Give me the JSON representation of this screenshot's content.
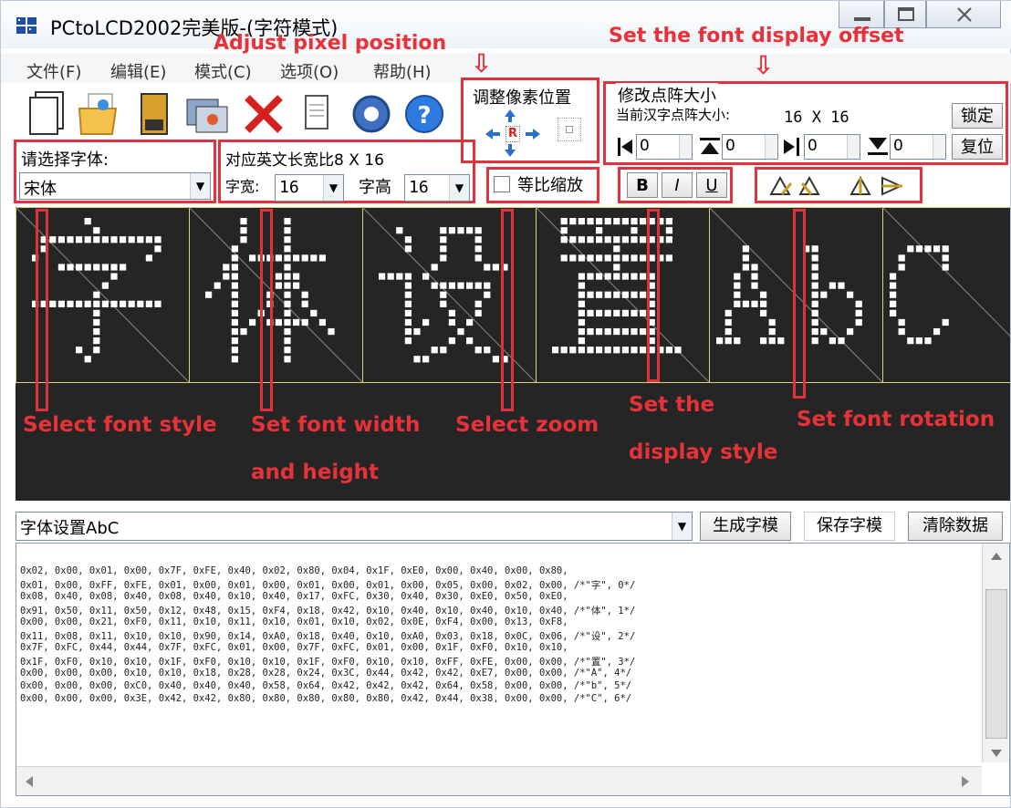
{
  "window": {
    "title": "PCtoLCD2002完美版-(字符模式)"
  },
  "menu": [
    "文件(F)",
    "编辑(E)",
    "模式(C)",
    "选项(O)",
    "帮助(H)"
  ],
  "toolbar": {
    "icons": [
      "new-file-icon",
      "open-folder-icon",
      "save-disk-icon",
      "settings-window-icon",
      "delete-x-icon",
      "notepad-icon",
      "gear-icon",
      "help-icon"
    ]
  },
  "pixel_group": {
    "label": "调整像素位置",
    "reset_label": "R"
  },
  "dot_group": {
    "label": "修改点阵大小",
    "size_label": "当前汉字点阵大小:",
    "size_value": "16 X 16",
    "lock_button": "锁定",
    "reset_button": "复位",
    "spin_values": [
      "0",
      "0",
      "0",
      "0"
    ]
  },
  "font_select": {
    "label": "请选择字体:",
    "value": "宋体"
  },
  "ratio_label": "对应英文长宽比8 X 16",
  "width_label": "字宽:",
  "width_value": "16",
  "height_label": "字高",
  "height_value": "16",
  "zoom_checkbox": "等比缩放",
  "style_buttons": [
    "B",
    "I",
    "U"
  ],
  "preview_text": "字体设置AbC",
  "annotations": {
    "adjust_pixel": "Adjust pixel position",
    "set_offset": "Set the font display offset",
    "font_style": "Select font style",
    "font_wh_1": "Set font width",
    "font_wh_2": "and height",
    "zoom": "Select zoom",
    "display_1": "Set the",
    "display_2": "display style",
    "rotation": "Set font rotation",
    "arrow_glyph": "⇩"
  },
  "bottom": {
    "input_value": "字体设置AbC",
    "generate_button": "生成字模",
    "save_button": "保存字模",
    "clear_button": "清除数据"
  },
  "output_lines": [
    "0x02, 0x00, 0x01, 0x00, 0x7F, 0xFE, 0x40, 0x02, 0x80, 0x04, 0x1F, 0xE0, 0x00, 0x40, 0x00, 0x80,",
    "0x01, 0x00, 0xFF, 0xFE, 0x01, 0x00, 0x01, 0x00, 0x01, 0x00, 0x01, 0x00, 0x05, 0x00, 0x02, 0x00, /*\"字\", 0*/",
    "0x08, 0x40, 0x08, 0x40, 0x08, 0x40, 0x10, 0x40, 0x17, 0xFC, 0x30, 0x40, 0x30, 0xE0, 0x50, 0xE0,",
    "0x91, 0x50, 0x11, 0x50, 0x12, 0x48, 0x15, 0xF4, 0x18, 0x42, 0x10, 0x40, 0x10, 0x40, 0x10, 0x40, /*\"体\", 1*/",
    "0x00, 0x00, 0x21, 0xF0, 0x11, 0x10, 0x11, 0x10, 0x01, 0x10, 0x02, 0x0E, 0xF4, 0x00, 0x13, 0xF8,",
    "0x11, 0x08, 0x11, 0x10, 0x10, 0x90, 0x14, 0xA0, 0x18, 0x40, 0x10, 0xA0, 0x03, 0x18, 0x0C, 0x06, /*\"设\", 2*/",
    "0x7F, 0xFC, 0x44, 0x44, 0x7F, 0xFC, 0x01, 0x00, 0x7F, 0xFC, 0x01, 0x00, 0x1F, 0xF0, 0x10, 0x10,",
    "0x1F, 0xF0, 0x10, 0x10, 0x1F, 0xF0, 0x10, 0x10, 0x1F, 0xF0, 0x10, 0x10, 0xFF, 0xFE, 0x00, 0x00, /*\"置\", 3*/",
    "0x00, 0x00, 0x00, 0x10, 0x10, 0x18, 0x28, 0x28, 0x24, 0x3C, 0x44, 0x42, 0x42, 0xE7, 0x00, 0x00, /*\"A\", 4*/",
    "0x00, 0x00, 0x00, 0xC0, 0x40, 0x40, 0x40, 0x58, 0x64, 0x42, 0x42, 0x42, 0x64, 0x58, 0x00, 0x00, /*\"b\", 5*/",
    "0x00, 0x00, 0x00, 0x3E, 0x42, 0x42, 0x80, 0x80, 0x80, 0x80, 0x80, 0x42, 0x44, 0x38, 0x00, 0x00, /*\"C\", 6*/"
  ]
}
